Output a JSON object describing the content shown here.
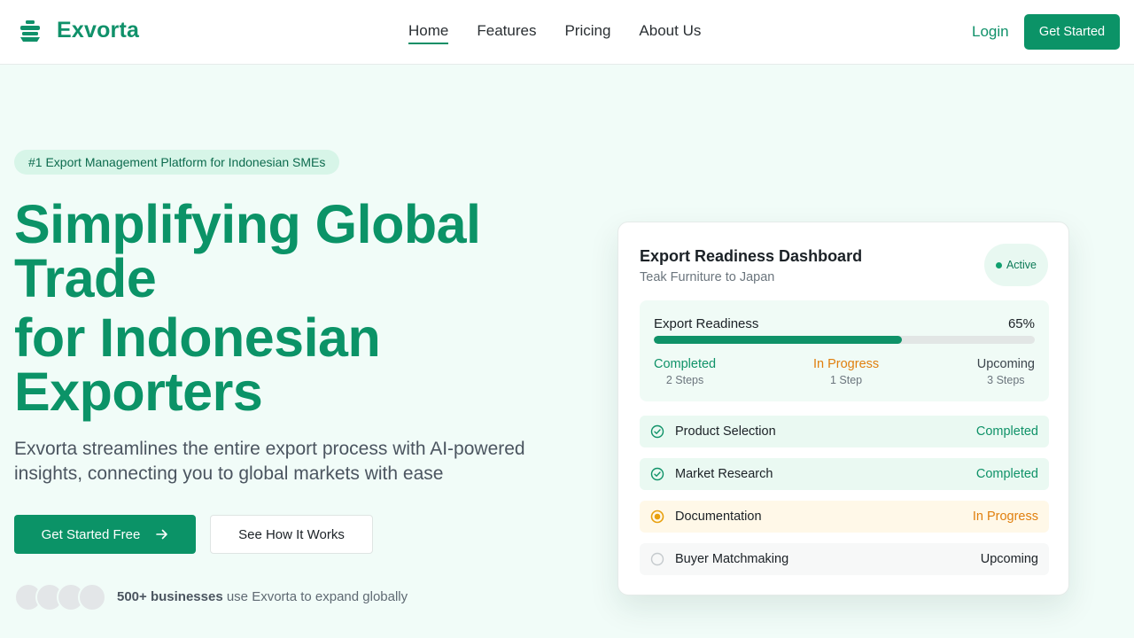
{
  "nav": {
    "brand": "Exvorta",
    "links": [
      "Home",
      "Features",
      "Pricing",
      "About Us"
    ],
    "active_link": "Home",
    "login": "Login",
    "cta": "Get Started"
  },
  "hero": {
    "badge": "#1 Export Management Platform for Indonesian SMEs",
    "headline_line1": "Simplifying Global Trade",
    "headline_line2": "for Indonesian Exporters",
    "subheadline": "Exvorta streamlines the entire export process with AI-powered insights, connecting you to global markets with ease",
    "primary_button": "Get Started Free",
    "secondary_button": "See How It Works",
    "social_proof_strong": "500+ businesses",
    "social_proof_rest": " use Exvorta to expand globally"
  },
  "dashboard": {
    "title": "Export Readiness Dashboard",
    "subtitle": "Teak Furniture to Japan",
    "status": "Active",
    "readiness_label": "Export Readiness",
    "readiness_percent_text": "65%",
    "readiness_fraction": 0.65,
    "stats": [
      {
        "label": "Completed",
        "count": "2 Steps"
      },
      {
        "label": "In Progress",
        "count": "1 Step"
      },
      {
        "label": "Upcoming",
        "count": "3 Steps"
      }
    ],
    "steps": [
      {
        "name": "Product Selection",
        "status": "Completed"
      },
      {
        "name": "Market Research",
        "status": "Completed"
      },
      {
        "name": "Documentation",
        "status": "In Progress"
      },
      {
        "name": "Buyer Matchmaking",
        "status": "Upcoming"
      }
    ]
  },
  "colors": {
    "brand": "#0b9367",
    "in_progress": "#e07f0e",
    "hero_bg": "#f1fcf8"
  }
}
